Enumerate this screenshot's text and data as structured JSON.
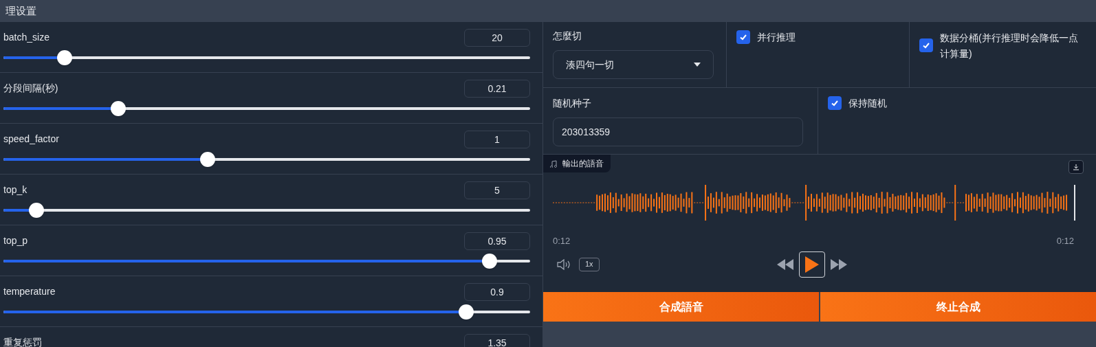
{
  "panel_title": "理设置",
  "sliders": [
    {
      "label": "batch_size",
      "value": "20",
      "level": 0.105
    },
    {
      "label": "分段间隔(秒)",
      "value": "0.21",
      "level": 0.21
    },
    {
      "label": "speed_factor",
      "value": "1",
      "level": 0.385
    },
    {
      "label": "top_k",
      "value": "5",
      "level": 0.05
    },
    {
      "label": "top_p",
      "value": "0.95",
      "level": 0.935
    },
    {
      "label": "temperature",
      "value": "0.9",
      "level": 0.89
    },
    {
      "label": "重复惩罚",
      "value": "1.35"
    }
  ],
  "split": {
    "label": "怎麼切",
    "value": "湊四句一切"
  },
  "parallel": {
    "label": "并行推理",
    "checked": true
  },
  "bucket": {
    "label": "数据分桶(并行推理时会降低一点计算量)",
    "checked": true
  },
  "seed": {
    "label": "随机种子",
    "value": "203013359"
  },
  "keep_random": {
    "label": "保持随机",
    "checked": true
  },
  "audio": {
    "label": "輸出的語音",
    "time_start": "0:12",
    "time_end": "0:12",
    "speed": "1x"
  },
  "buttons": [
    "合成語音",
    "终止合成"
  ]
}
